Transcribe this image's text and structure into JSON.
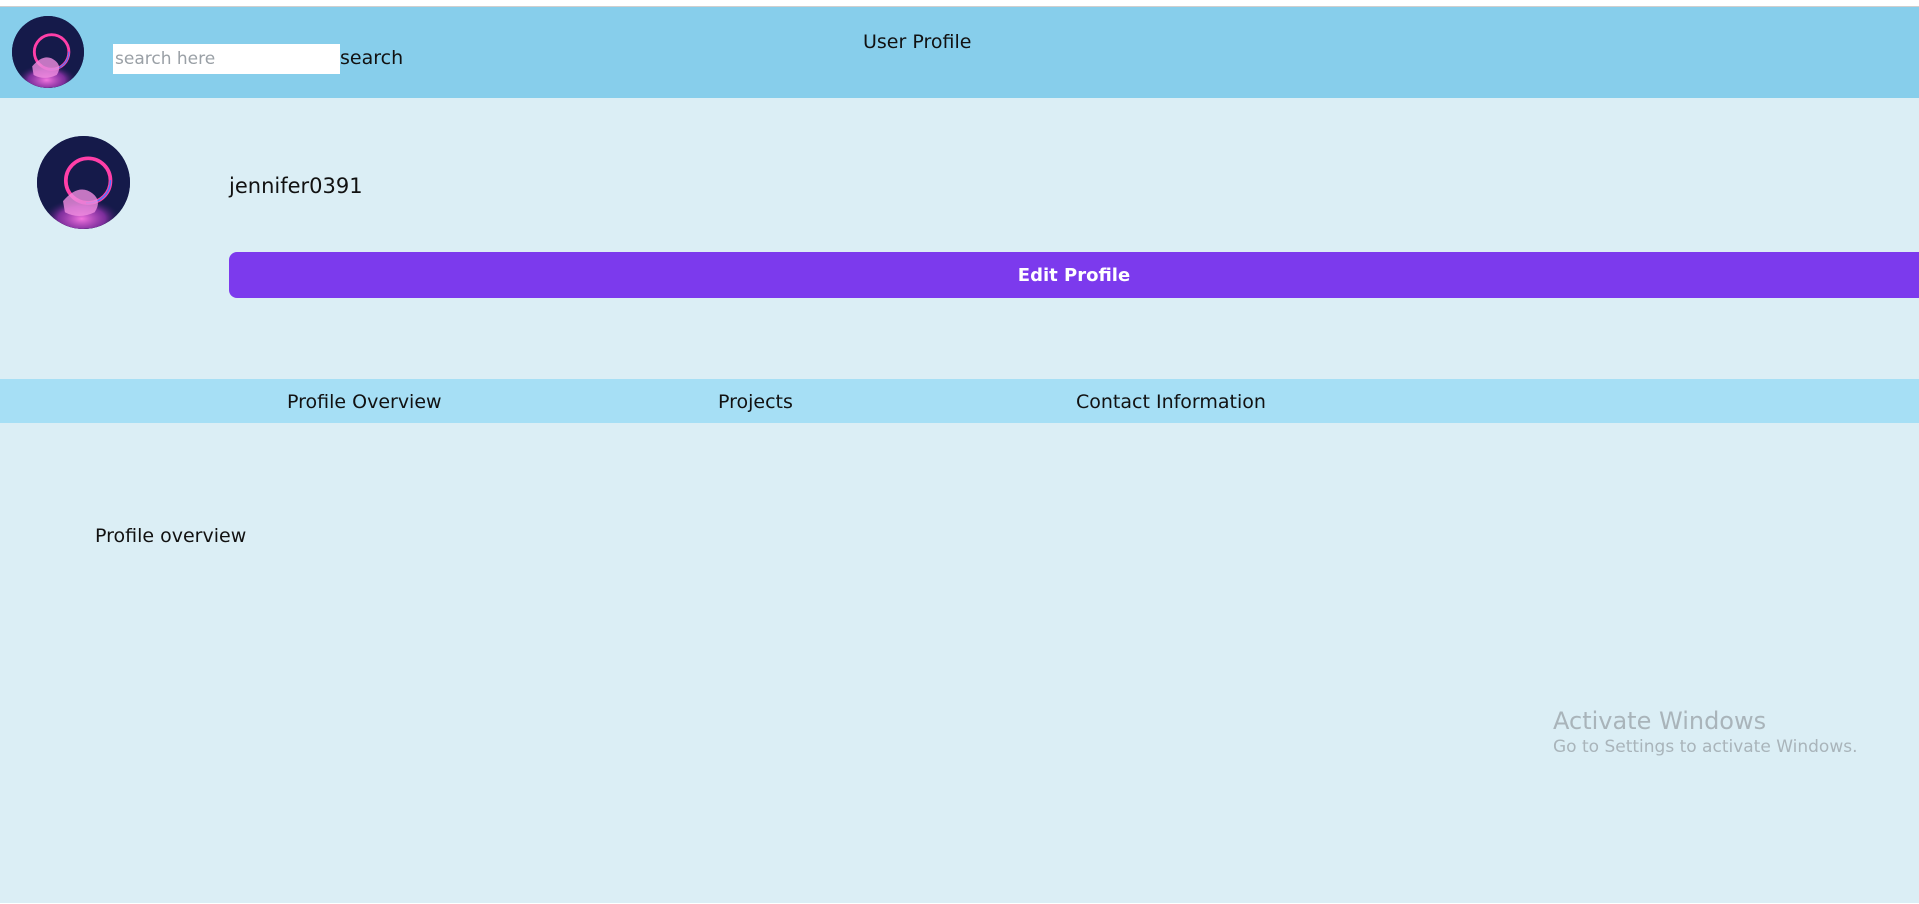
{
  "header": {
    "search": {
      "placeholder": "search here",
      "value": "",
      "button_label": "search"
    },
    "title": "User Profile",
    "avatar_icon": "neon-ring-avatar"
  },
  "profile": {
    "username": "jennifer0391",
    "edit_button_label": "Edit Profile",
    "accent_color": "#7c3aed"
  },
  "tabs": [
    {
      "label": "Profile Overview"
    },
    {
      "label": "Projects"
    },
    {
      "label": "Contact Information"
    }
  ],
  "content": {
    "section_heading": "Profile overview"
  },
  "watermark": {
    "title": "Activate Windows",
    "subtitle": "Go to Settings to activate Windows."
  },
  "colors": {
    "header_bg": "#87ceeb",
    "main_bg": "#dbeef5",
    "tabs_bg": "#a6dff5"
  }
}
